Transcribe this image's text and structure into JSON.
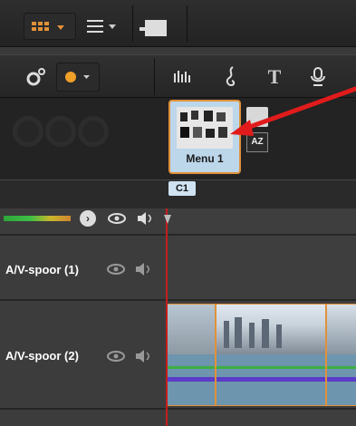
{
  "toolbar": {
    "grid_view": "grid-view",
    "list_view": "list-view",
    "folder": "folder"
  },
  "toolbar2": {
    "settings": "settings",
    "color": "color",
    "audio": "audio-levels",
    "music": "music-note",
    "text": "T",
    "mic": "microphone"
  },
  "menu": {
    "label": "Menu 1",
    "az_label": "AZ"
  },
  "ruler": {
    "chapter": "C1"
  },
  "tracks": [
    {
      "name": "A/V-spoor (1)"
    },
    {
      "name": "A/V-spoor (2)"
    }
  ],
  "colors": {
    "accent": "#e0913a",
    "playhead": "#c41d1d",
    "arrow": "#e11b1b"
  }
}
